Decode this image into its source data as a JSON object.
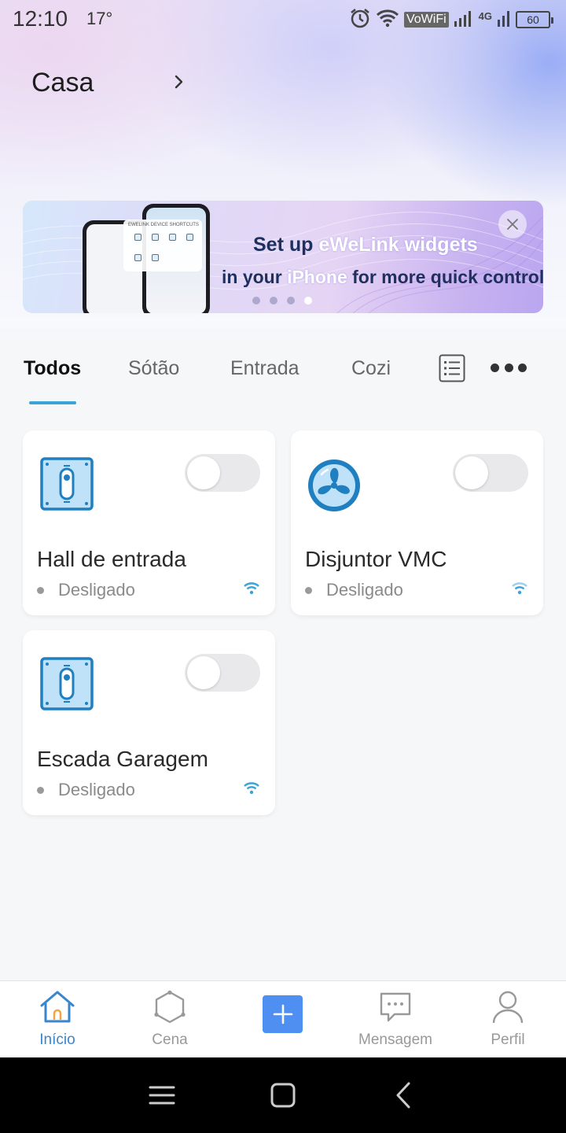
{
  "status_bar": {
    "time": "12:10",
    "temperature": "17°",
    "vowifi": "VoWiFi",
    "network": "4G",
    "battery": "60"
  },
  "home": {
    "title": "Casa"
  },
  "banner": {
    "line1_prefix": "Set up ",
    "line1_highlight": "eWeLink widgets",
    "line2_prefix": "in your ",
    "line2_highlight": "iPhone",
    "line2_suffix": " for more quick control",
    "phone_widget_title": "EWELINK DEVICE SHORTCUTS",
    "page_count": 4,
    "active_page": 4
  },
  "tabs": [
    {
      "label": "Todos",
      "active": true
    },
    {
      "label": "Sótão",
      "active": false
    },
    {
      "label": "Entrada",
      "active": false
    },
    {
      "label": "Cozi",
      "active": false
    }
  ],
  "devices": [
    {
      "name": "Hall de entrada",
      "status": "Desligado",
      "icon": "switch-panel-icon",
      "on": false
    },
    {
      "name": "Disjuntor VMC",
      "status": "Desligado",
      "icon": "fan-icon",
      "on": false
    },
    {
      "name": "Escada Garagem",
      "status": "Desligado",
      "icon": "switch-panel-icon",
      "on": false
    }
  ],
  "bottom_nav": {
    "home": "Início",
    "scene": "Cena",
    "messages": "Mensagem",
    "profile": "Perfil"
  },
  "colors": {
    "accent": "#3ba4d6",
    "active_nav": "#3a86cc",
    "add_button": "#4f8ff2",
    "device_icon": "#1f7fc0"
  }
}
